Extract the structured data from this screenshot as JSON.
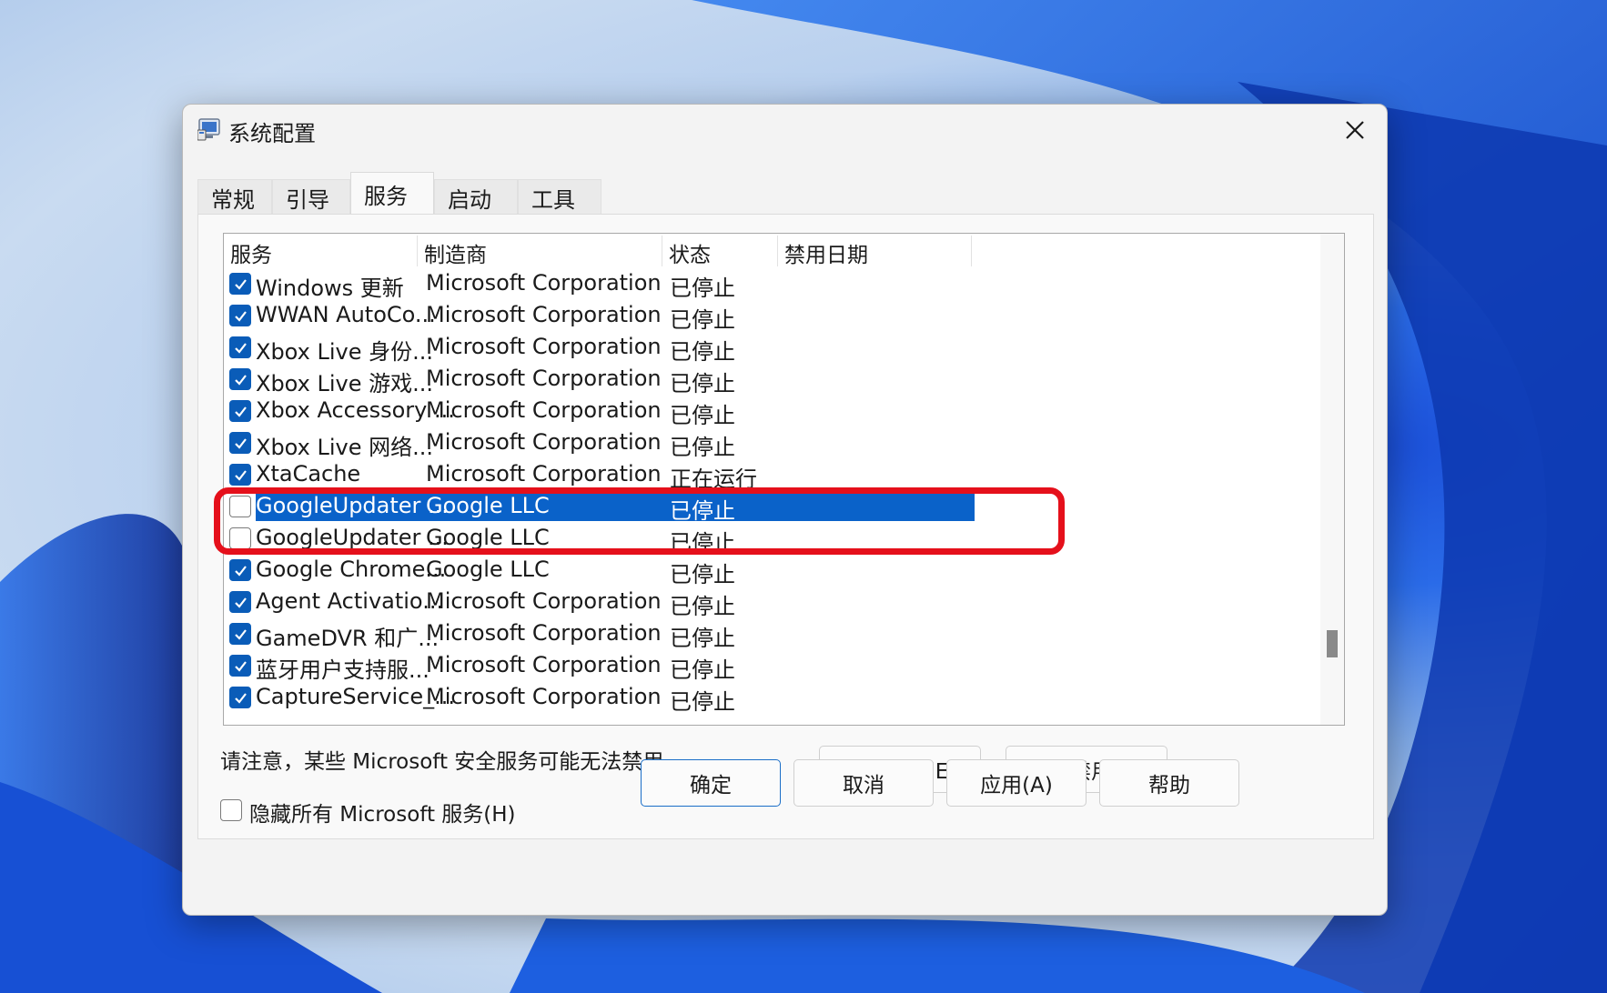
{
  "window": {
    "title": "系统配置"
  },
  "tabs": [
    {
      "label": "常规"
    },
    {
      "label": "引导"
    },
    {
      "label": "服务"
    },
    {
      "label": "启动"
    },
    {
      "label": "工具"
    }
  ],
  "active_tab": "服务",
  "table": {
    "columns": [
      "服务",
      "制造商",
      "状态",
      "禁用日期"
    ],
    "rows": [
      {
        "checked": true,
        "service": "Windows 更新",
        "maker": "Microsoft Corporation",
        "status": "已停止"
      },
      {
        "checked": true,
        "service": "WWAN AutoCo...",
        "maker": "Microsoft Corporation",
        "status": "已停止"
      },
      {
        "checked": true,
        "service": "Xbox Live 身份...",
        "maker": "Microsoft Corporation",
        "status": "已停止"
      },
      {
        "checked": true,
        "service": "Xbox Live 游戏...",
        "maker": "Microsoft Corporation",
        "status": "已停止"
      },
      {
        "checked": true,
        "service": "Xbox Accessory ...",
        "maker": "Microsoft Corporation",
        "status": "已停止"
      },
      {
        "checked": true,
        "service": "Xbox Live 网络...",
        "maker": "Microsoft Corporation",
        "status": "已停止"
      },
      {
        "checked": true,
        "service": "XtaCache",
        "maker": "Microsoft Corporation",
        "status": "正在运行"
      },
      {
        "checked": false,
        "service": "GoogleUpdater ...",
        "maker": "Google LLC",
        "status": "已停止",
        "selected": true
      },
      {
        "checked": false,
        "service": "GoogleUpdater ...",
        "maker": "Google LLC",
        "status": "已停止"
      },
      {
        "checked": true,
        "service": "Google Chrome...",
        "maker": "Google LLC",
        "status": "已停止"
      },
      {
        "checked": true,
        "service": "Agent Activatio...",
        "maker": "Microsoft Corporation",
        "status": "已停止"
      },
      {
        "checked": true,
        "service": "GameDVR 和广...",
        "maker": "Microsoft Corporation",
        "status": "已停止"
      },
      {
        "checked": true,
        "service": "蓝牙用户支持服...",
        "maker": "Microsoft Corporation",
        "status": "已停止"
      },
      {
        "checked": true,
        "service": "CaptureService_...",
        "maker": "Microsoft Corporation",
        "status": "已停止"
      }
    ]
  },
  "note": "请注意，某些 Microsoft 安全服务可能无法禁用。",
  "buttons": {
    "enable_all": "全部启用(E)",
    "disable_all": "全部禁用(D)",
    "ok": "确定",
    "cancel": "取消",
    "apply": "应用(A)",
    "help": "帮助"
  },
  "hide_ms": {
    "label": "隐藏所有 Microsoft 服务(H)",
    "checked": false
  },
  "colors": {
    "accent": "#0a62c9",
    "highlight_box": "#e5101b"
  }
}
